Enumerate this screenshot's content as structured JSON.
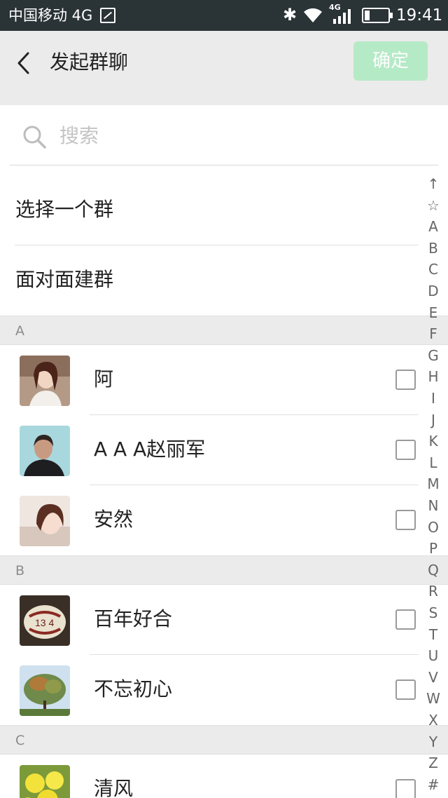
{
  "status_bar": {
    "carrier": "中国移动 4G",
    "network_label": "4G",
    "time": "19:41",
    "icons": [
      "sim-icon",
      "bluetooth-icon",
      "wifi-icon",
      "signal-icon",
      "battery-icon"
    ]
  },
  "header": {
    "title": "发起群聊",
    "confirm_label": "确定",
    "back_icon": "chevron-left-icon",
    "confirm_color": "#b3eac5"
  },
  "search": {
    "placeholder": "搜索",
    "icon": "search-icon"
  },
  "menu": [
    {
      "label": "选择一个群"
    },
    {
      "label": "面对面建群"
    }
  ],
  "sections": [
    {
      "letter": "A",
      "contacts": [
        {
          "name": "阿",
          "checked": false
        },
        {
          "name": "A A A赵丽军",
          "checked": false
        },
        {
          "name": "安然",
          "checked": false
        }
      ]
    },
    {
      "letter": "B",
      "contacts": [
        {
          "name": "百年好合",
          "checked": false
        },
        {
          "name": "不忘初心",
          "checked": false
        }
      ]
    },
    {
      "letter": "C",
      "contacts": [
        {
          "name": "清风",
          "checked": false
        }
      ]
    }
  ],
  "index_bar": [
    "↑",
    "☆",
    "A",
    "B",
    "C",
    "D",
    "E",
    "F",
    "G",
    "H",
    "I",
    "J",
    "K",
    "L",
    "M",
    "N",
    "O",
    "P",
    "Q",
    "R",
    "S",
    "T",
    "U",
    "V",
    "W",
    "X",
    "Y",
    "Z",
    "#"
  ],
  "colors": {
    "status_bar_bg": "#2a3336",
    "header_bg": "#ebebeb",
    "section_bg": "#ebebeb"
  }
}
